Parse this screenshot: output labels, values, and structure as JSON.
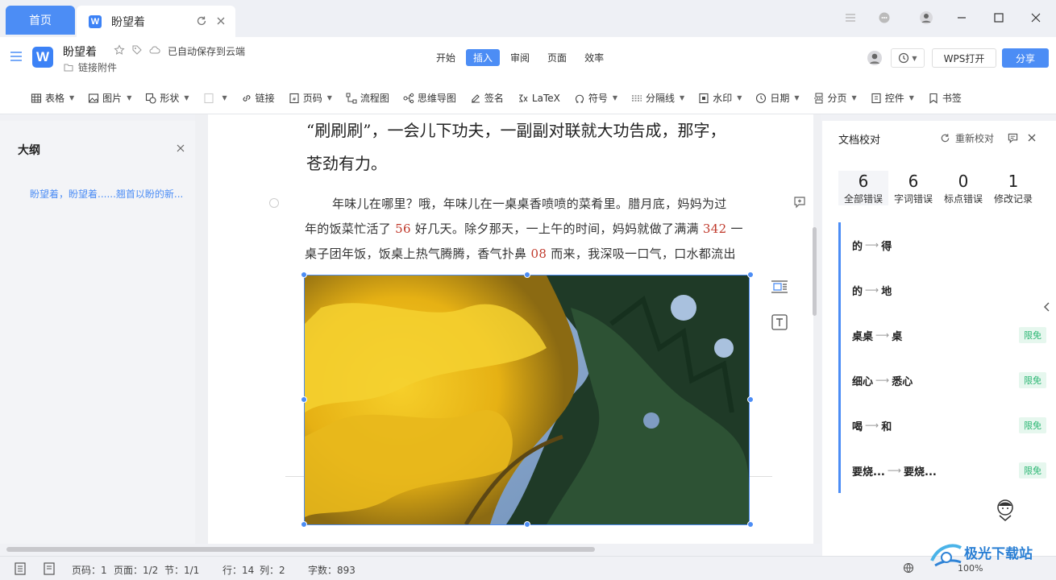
{
  "tabs": {
    "home": "首页",
    "doc": "盼望着"
  },
  "header": {
    "doc_name": "盼望着",
    "attachment": "链接附件",
    "autosave": "已自动保存到云端",
    "wps_open": "WPS打开",
    "share": "分享"
  },
  "menu_tabs": [
    {
      "label": "开始",
      "active": false
    },
    {
      "label": "插入",
      "active": true
    },
    {
      "label": "审阅",
      "active": false
    },
    {
      "label": "页面",
      "active": false
    },
    {
      "label": "效率",
      "active": false
    }
  ],
  "toolbar": [
    {
      "label": "表格",
      "icon": "table-icon",
      "dropdown": true
    },
    {
      "label": "图片",
      "icon": "image-icon",
      "dropdown": true
    },
    {
      "label": "形状",
      "icon": "shape-icon",
      "dropdown": true
    },
    {
      "label": "",
      "icon": "disabled-icon",
      "dropdown": true,
      "disabled": true
    },
    {
      "label": "链接",
      "icon": "link-icon",
      "dropdown": false
    },
    {
      "label": "页码",
      "icon": "page-number-icon",
      "dropdown": true
    },
    {
      "label": "流程图",
      "icon": "flowchart-icon",
      "dropdown": false
    },
    {
      "label": "思维导图",
      "icon": "mindmap-icon",
      "dropdown": false
    },
    {
      "label": "签名",
      "icon": "signature-icon",
      "dropdown": false
    },
    {
      "label": "LaTeX",
      "icon": "latex-icon",
      "dropdown": false
    },
    {
      "label": "符号",
      "icon": "symbol-icon",
      "dropdown": true
    },
    {
      "label": "分隔线",
      "icon": "divider-icon",
      "dropdown": true
    },
    {
      "label": "水印",
      "icon": "watermark-icon",
      "dropdown": true
    },
    {
      "label": "日期",
      "icon": "date-icon",
      "dropdown": true
    },
    {
      "label": "分页",
      "icon": "pagebreak-icon",
      "dropdown": true
    },
    {
      "label": "控件",
      "icon": "control-icon",
      "dropdown": true
    },
    {
      "label": "书签",
      "icon": "bookmark-icon",
      "dropdown": false
    }
  ],
  "outline": {
    "title": "大纲",
    "item": "盼望着，盼望着......翘首以盼的新..."
  },
  "document": {
    "line1": "“刷刷刷”，一会儿下功夫，一副副对联就大功告成，那字，",
    "line2": "苍劲有力。",
    "p1": "年味儿在哪里？哦，年味儿在一桌桌香喷喷的菜肴里。腊月底，妈妈为过",
    "p2_a": "年的饭菜忙活了 ",
    "p2_n": "56",
    "p2_b": " 好几天。除夕那天，一上午的时间，妈妈就做了满满 ",
    "p2_m": "342",
    "p2_c": " 一",
    "p3_a": "桌子团年饭，饭桌上热气腾腾，香气扑鼻 ",
    "p3_n": "08",
    "p3_b": " 而来，我深吸一口气，口水都流出"
  },
  "proofread": {
    "title": "文档校对",
    "recheck": "重新校对",
    "stats": [
      {
        "num": "6",
        "label": "全部错误"
      },
      {
        "num": "6",
        "label": "字词错误"
      },
      {
        "num": "0",
        "label": "标点错误"
      },
      {
        "num": "1",
        "label": "修改记录"
      }
    ],
    "items": [
      {
        "wrong": "的",
        "fix": "得",
        "badge": ""
      },
      {
        "wrong": "的",
        "fix": "地",
        "badge": ""
      },
      {
        "wrong": "桌桌",
        "fix": "桌",
        "badge": "限免"
      },
      {
        "wrong": "细心",
        "fix": "悉心",
        "badge": "限免"
      },
      {
        "wrong": "喝",
        "fix": "和",
        "badge": "限免"
      },
      {
        "wrong": "要烧...",
        "fix": "要烧...",
        "badge": "限免"
      }
    ]
  },
  "status": {
    "page": "页码：1",
    "pages": "页面：1/2",
    "section": "节：1/1",
    "row": "行：14",
    "col": "列：2",
    "words": "字数：893",
    "zoom": "100%"
  },
  "watermark": "极光下载站",
  "colors": {
    "accent": "#4c8df5",
    "free_badge": "#2bb673",
    "error_number": "#c0392b"
  }
}
